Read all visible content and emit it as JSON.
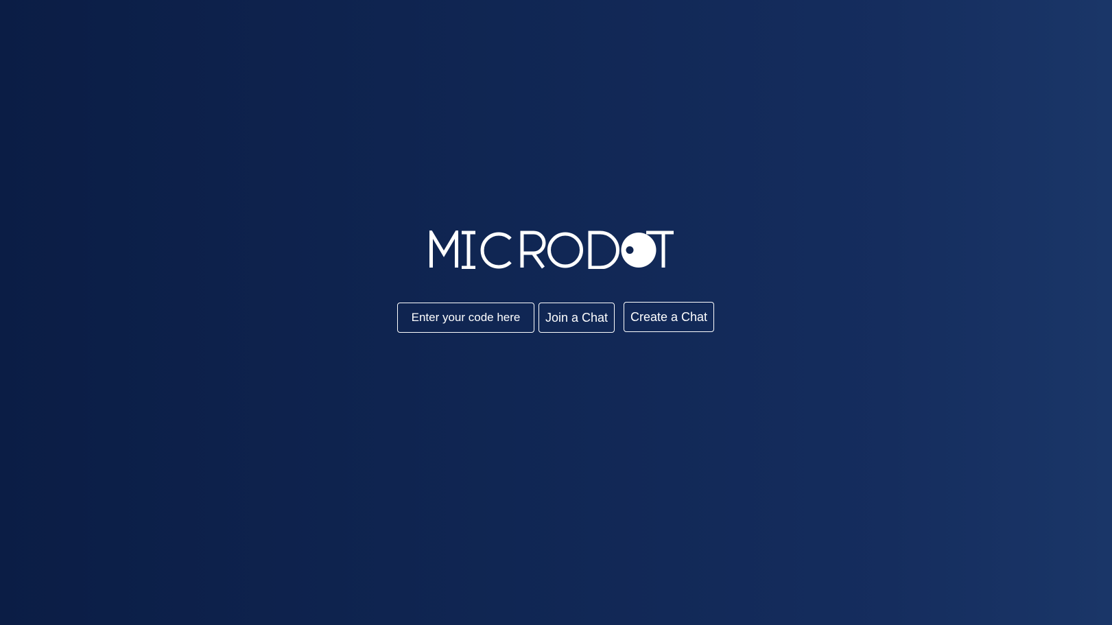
{
  "brand": {
    "name": "MICRODOT",
    "color": "#ffffff"
  },
  "chat_entry": {
    "code_placeholder": "Enter your code here",
    "code_value": "",
    "join_label": "Join a Chat",
    "create_label": "Create a Chat"
  },
  "theme": {
    "background_start": "#0b1d45",
    "background_end": "#1a3668",
    "foreground": "#ffffff"
  }
}
